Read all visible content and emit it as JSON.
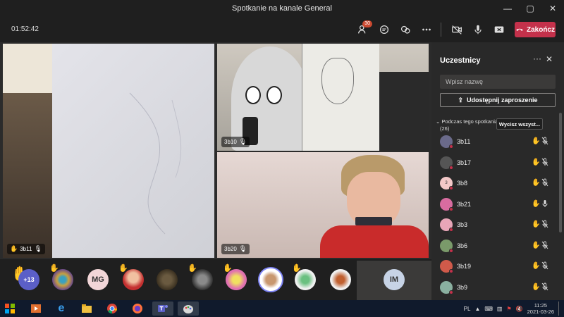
{
  "window": {
    "title": "Spotkanie na kanale General",
    "minimize": "—",
    "maximize": "▢",
    "close": "✕"
  },
  "toolbar": {
    "timer": "01:52:42",
    "participants_badge": "30",
    "leave_label": "Zakończ",
    "icons": [
      "participants-icon",
      "chat-icon",
      "reactions-icon",
      "more-icon",
      "camera-off-icon",
      "microphone-icon",
      "share-screen-icon",
      "phone-hangup-icon"
    ]
  },
  "tiles": [
    {
      "name": "3b11"
    },
    {
      "name": "3b10"
    },
    {
      "name": "3b20"
    }
  ],
  "strip": {
    "overflow": "+13",
    "initials_mg": "MG",
    "initials_im": "IM"
  },
  "panel": {
    "title": "Uczestnicy",
    "more": "···",
    "close": "✕",
    "search_placeholder": "Wpisz nazwę",
    "share_label": "Udostępnij zaproszenie",
    "section_line1": "Podczas tego spotkania",
    "section_line2": "(26)",
    "mute_all": "Wycisz wszyst...",
    "participants": [
      {
        "name": "3b11",
        "initial": "",
        "color": "#6a6a8a",
        "hand": true,
        "mic": "muted"
      },
      {
        "name": "3b17",
        "initial": "",
        "color": "#555555",
        "hand": true,
        "mic": "muted"
      },
      {
        "name": "3b8",
        "initial": "3",
        "color": "#f3c8c8",
        "hand": true,
        "mic": "muted"
      },
      {
        "name": "3b21",
        "initial": "",
        "color": "#d86ca0",
        "hand": true,
        "mic": "on"
      },
      {
        "name": "3b3",
        "initial": "",
        "color": "#e8a6b8",
        "hand": true,
        "mic": "muted"
      },
      {
        "name": "3b6",
        "initial": "",
        "color": "#7a9a6a",
        "hand": true,
        "mic": "muted"
      },
      {
        "name": "3b19",
        "initial": "",
        "color": "#d05a4a",
        "hand": true,
        "mic": "muted"
      },
      {
        "name": "3b9",
        "initial": "",
        "color": "#8ab0a0",
        "hand": true,
        "mic": "muted"
      }
    ]
  },
  "taskbar": {
    "language": "PL",
    "time": "11:25",
    "date": "2021-03-26"
  }
}
